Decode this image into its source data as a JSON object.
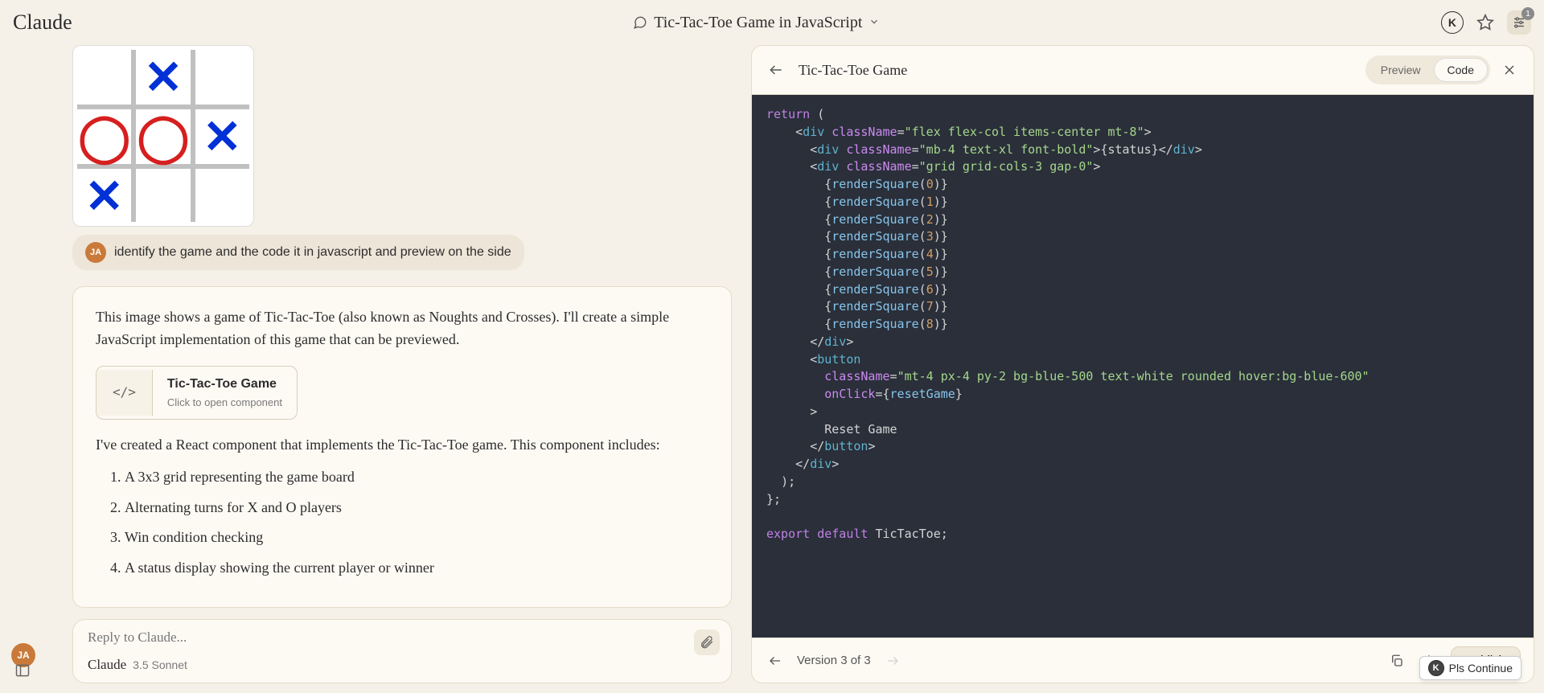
{
  "header": {
    "logo": "Claude",
    "title": "Tic-Tac-Toe Game in JavaScript",
    "k_badge": "K",
    "sliders_badge": "1"
  },
  "board": {
    "cells": [
      "",
      "X",
      "",
      "O",
      "O",
      "X",
      "X",
      "",
      ""
    ]
  },
  "user": {
    "avatar": "JA",
    "message": "identify the game and the code it in javascript and preview on the side"
  },
  "assistant": {
    "intro": "This image shows a game of Tic-Tac-Toe (also known as Noughts and Crosses). I'll create a simple JavaScript implementation of this game that can be previewed.",
    "chip": {
      "icon": "</>",
      "title": "Tic-Tac-Toe Game",
      "subtitle": "Click to open component"
    },
    "after_chip": "I've created a React component that implements the Tic-Tac-Toe game. This component includes:",
    "items": [
      "A 3x3 grid representing the game board",
      "Alternating turns for X and O players",
      "Win condition checking",
      "A status display showing the current player or winner"
    ]
  },
  "reply": {
    "placeholder": "Reply to Claude...",
    "model_name": "Claude",
    "model_version": "3.5 Sonnet"
  },
  "artifact": {
    "title": "Tic-Tac-Toe Game",
    "tabs": {
      "preview": "Preview",
      "code": "Code"
    },
    "version": "Version 3 of 3",
    "publish": "Publish",
    "code": {
      "return": "return",
      "div": "div",
      "button": "button",
      "className": "className",
      "onClick": "onClick",
      "cls_outer": "\"flex flex-col items-center mt-8\"",
      "cls_status": "\"mb-4 text-xl font-bold\"",
      "cls_grid": "\"grid grid-cols-3 gap-0\"",
      "cls_btn": "\"mt-4 px-4 py-2 bg-blue-500 text-white rounded hover:bg-blue-600\"",
      "renderSquare": "renderSquare",
      "status_expr": "status",
      "resetGame": "resetGame",
      "reset_label": "Reset Game",
      "export": "export",
      "default": "default",
      "component": "TicTacToe"
    }
  },
  "continue_pill": "Pls Continue"
}
